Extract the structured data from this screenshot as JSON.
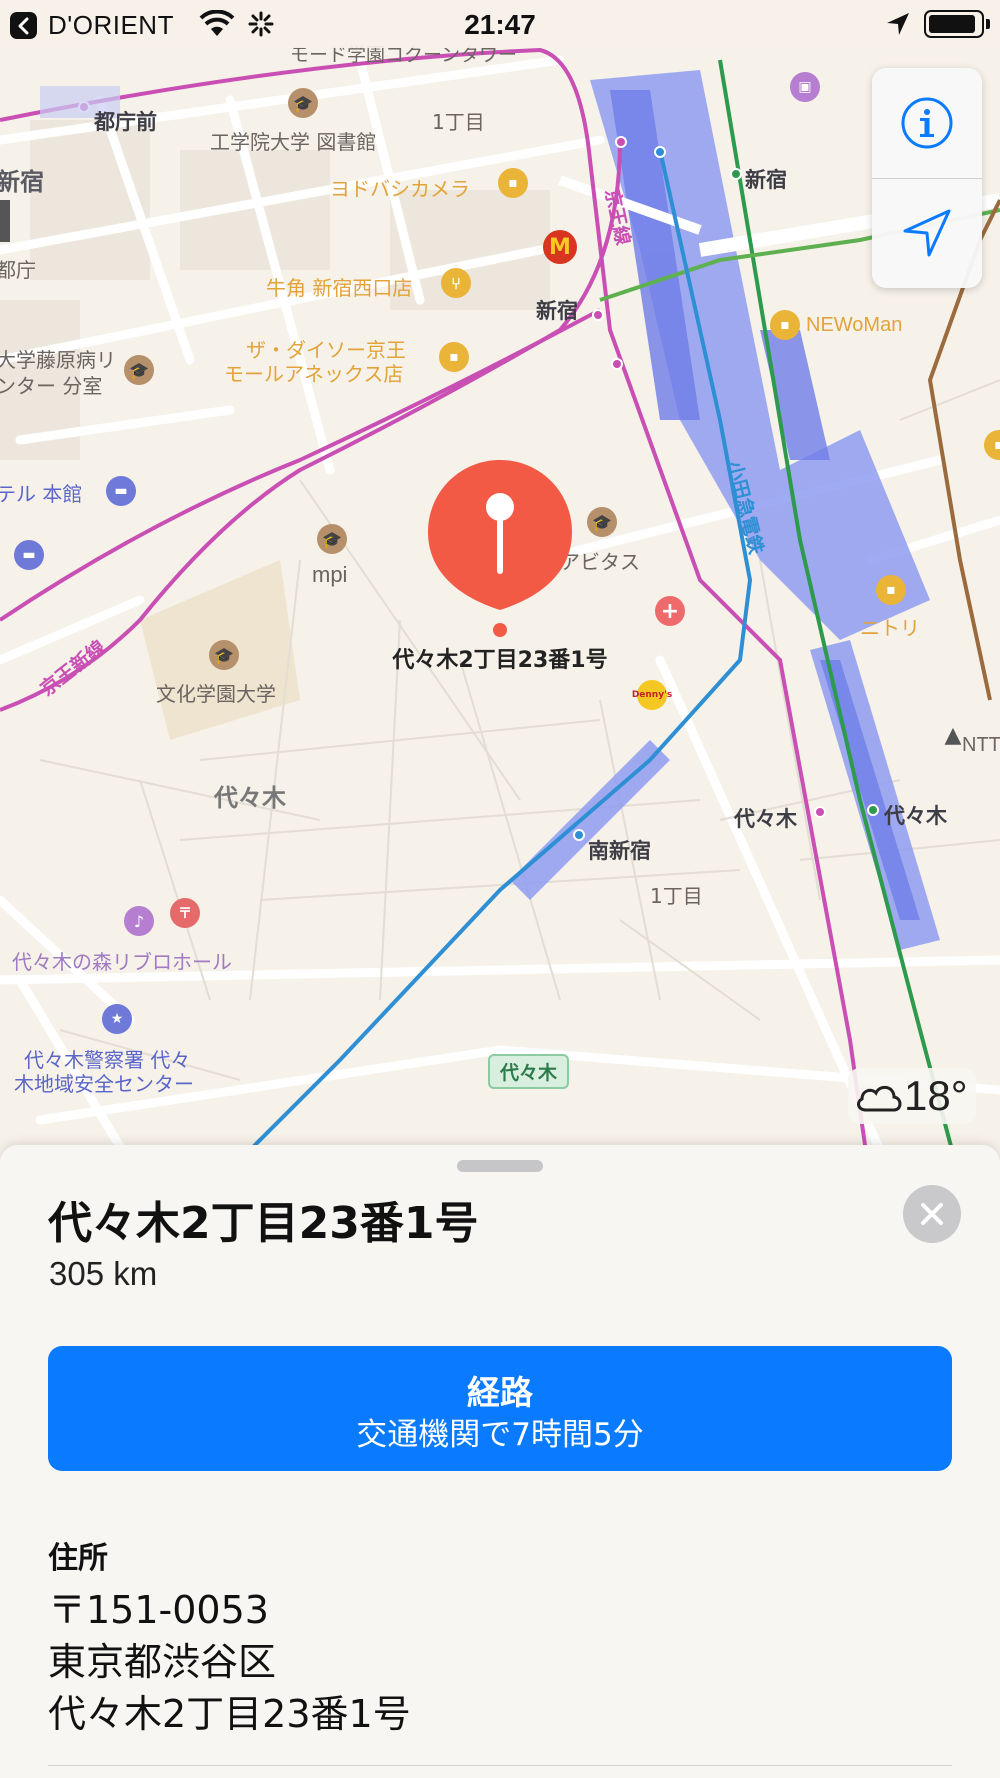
{
  "status_bar": {
    "carrier": "D'ORIENT",
    "time": "21:47",
    "battery_level": 0.92
  },
  "map": {
    "labels": {
      "tochomae": "都庁前",
      "kogakuin_library": "工学院大学 図書館",
      "chome1_top": "1丁目",
      "yodobashi": "ヨドバシカメラ",
      "shinjuku_left": "新宿",
      "tocho": "都庁",
      "gyukaku": "牛角 新宿西口店",
      "daiso_line1": "ザ・ダイソー京王",
      "daiso_line2": "モールアネックス店",
      "hospital_line1": "大学藤原病リ",
      "hospital_line2": "ンター 分室",
      "hotel": "テル 本館",
      "shinjuku_station_label": "新宿",
      "shinjuku_east": "新宿",
      "newoman": "NEWoMan",
      "keio_line": "京王線",
      "keio_new_line": "京王新線",
      "odakyu_line": "小田急電鉄",
      "mpi": "mpi",
      "avitas": "アビタス",
      "bunka_gakuen": "文化学園大学",
      "nitori": "ニトリ",
      "yoyogi_area": "代々木",
      "yoyogi_station_left": "代々木",
      "yoyogi_station_right": "代々木",
      "minami_shinjuku": "南新宿",
      "chome1_bottom": "1丁目",
      "ntt": "NTT",
      "rebro_hall": "代々木の森リブロホール",
      "police_line1": "代々木警察署 代々",
      "police_line2": "木地域安全センター",
      "route_sign": "代々木",
      "dennys": "Denny's",
      "top_cut": "モード学園コクーンタワー"
    },
    "pin_label": "代々木2丁目23番1号",
    "weather_temp": "18°"
  },
  "sheet": {
    "title": "代々木2丁目23番1号",
    "distance": "305 km",
    "route_label": "経路",
    "route_sub": "交通機関で7時間5分",
    "address_heading": "住所",
    "address_lines": [
      "〒151-0053",
      "東京都渋谷区",
      "代々木2丁目23番1号"
    ]
  },
  "colors": {
    "accent": "#0a7aff",
    "pin": "#f25a45",
    "rail_keio": "#c94fb4",
    "rail_jr_green": "#2e9a4d",
    "rail_odakyu": "#2f8fd4"
  },
  "icons": {
    "info": "info-icon",
    "locate": "location-arrow-icon",
    "close": "close-icon",
    "weather": "cloud-icon"
  }
}
